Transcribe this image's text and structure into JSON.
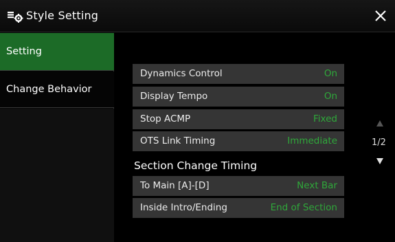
{
  "window": {
    "title": "Style Setting",
    "icon": "style-setting-icon",
    "close_icon": "close-icon"
  },
  "sidebar": {
    "items": [
      {
        "label": "Setting",
        "active": true
      },
      {
        "label": "Change Behavior",
        "active": false
      }
    ]
  },
  "settings": [
    {
      "label": "Dynamics Control",
      "value": "On"
    },
    {
      "label": "Display Tempo",
      "value": "On"
    },
    {
      "label": "Stop ACMP",
      "value": "Fixed"
    },
    {
      "label": "OTS Link Timing",
      "value": "Immediate"
    }
  ],
  "section_change": {
    "heading": "Section Change Timing",
    "rows": [
      {
        "label": "To Main [A]-[D]",
        "value": "Next Bar"
      },
      {
        "label": "Inside Intro/Ending",
        "value": "End of Section"
      }
    ]
  },
  "pagination": {
    "label": "1/2",
    "up_icon": "page-up-icon",
    "down_icon": "page-down-icon"
  },
  "colors": {
    "accent": "#1c6b27",
    "value_text": "#2fa83a",
    "row_bg": "#353535"
  }
}
